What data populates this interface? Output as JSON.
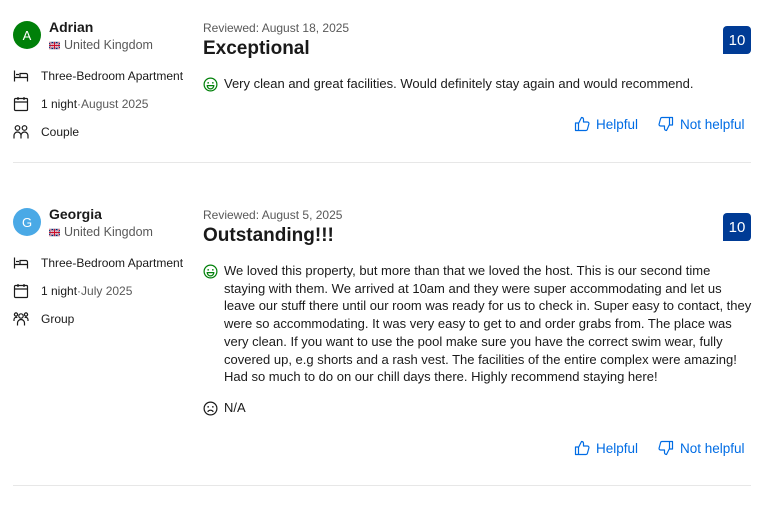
{
  "reviews": [
    {
      "avatar_letter": "A",
      "avatar_color": "#008009",
      "name": "Adrian",
      "country": "United Kingdom",
      "room": "Three-Bedroom Apartment",
      "stay_nights": "1 night",
      "stay_sep": " · ",
      "stay_date": "August 2025",
      "traveler_type": "Couple",
      "reviewed_date": "Reviewed: August 18, 2025",
      "title": "Exceptional",
      "score": "10",
      "positive": "Very clean and great facilities. Would definitely stay again and would recommend.",
      "helpful_label": "Helpful",
      "not_helpful_label": "Not helpful"
    },
    {
      "avatar_letter": "G",
      "avatar_color": "#4aa9e6",
      "name": "Georgia",
      "country": "United Kingdom",
      "room": "Three-Bedroom Apartment",
      "stay_nights": "1 night",
      "stay_sep": " · ",
      "stay_date": "July 2025",
      "traveler_type": "Group",
      "reviewed_date": "Reviewed: August 5, 2025",
      "title": "Outstanding!!!",
      "score": "10",
      "positive": "We loved this property, but more than that we loved the host. This is our second time staying with them. We arrived at 10am and they were super accommodating and let us leave our stuff there until our room was ready for us to check in. Super easy to contact, they were so accommodating. It was very easy to get to and order grabs from. The place was very clean. If you want to use the pool make sure you have the correct swim wear, fully covered up, e.g shorts and a rash vest. The facilities of the entire complex were amazing! Had so much to do on our chill days there. Highly recommend staying here!",
      "negative": "N/A",
      "helpful_label": "Helpful",
      "not_helpful_label": "Not helpful"
    }
  ],
  "colors": {
    "score_bg": "#003b95",
    "link": "#006ce4",
    "positive_icon": "#008009",
    "negative_icon": "#1a1a1a"
  },
  "icons": [
    "bed-icon",
    "calendar-icon",
    "couple-icon",
    "group-icon",
    "smile-icon",
    "frown-icon",
    "thumbs-up-icon",
    "thumbs-down-icon",
    "uk-flag-icon"
  ]
}
